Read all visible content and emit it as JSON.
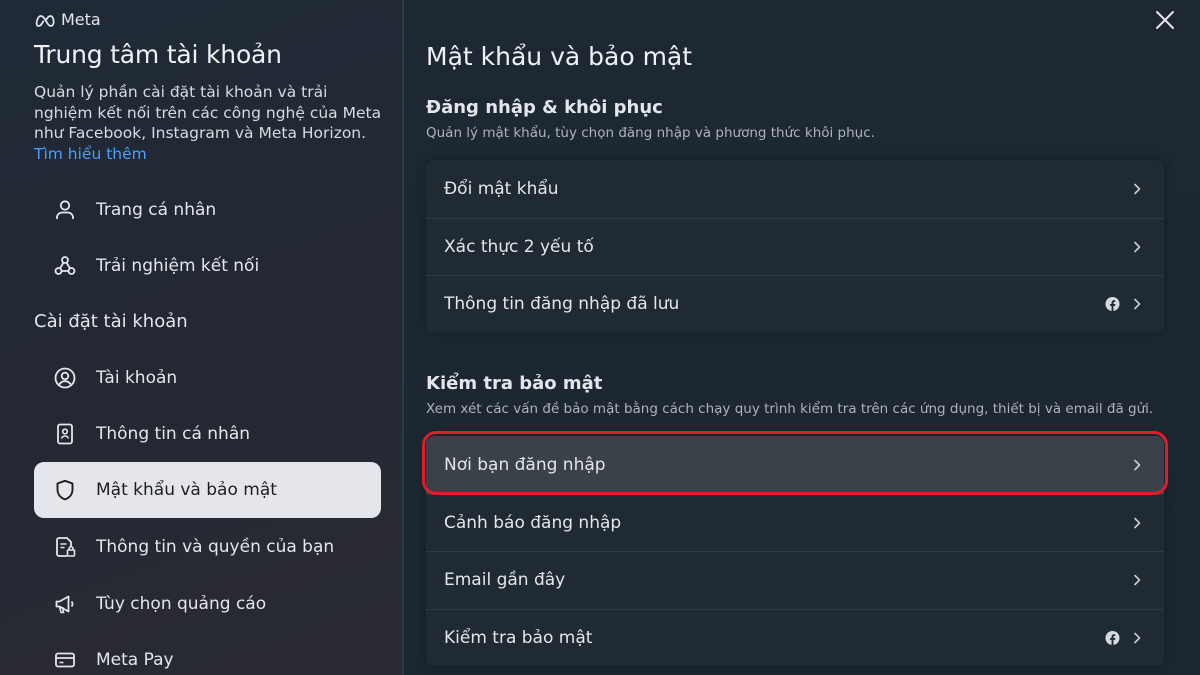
{
  "brand": {
    "logo_text": "Meta"
  },
  "sidebar": {
    "title": "Trung tâm tài khoản",
    "description": "Quản lý phần cài đặt tài khoản và trải nghiệm kết nối trên các công nghệ của Meta như Facebook, Instagram và Meta Horizon.",
    "learn_more": "Tìm hiểu thêm",
    "top_items": [
      {
        "label": "Trang cá nhân",
        "icon": "person-icon"
      },
      {
        "label": "Trải nghiệm kết nối",
        "icon": "connected-nodes-icon"
      }
    ],
    "section_label": "Cài đặt tài khoản",
    "items": [
      {
        "label": "Tài khoản",
        "icon": "account-circle-icon"
      },
      {
        "label": "Thông tin cá nhân",
        "icon": "id-card-icon"
      },
      {
        "label": "Mật khẩu và bảo mật",
        "icon": "shield-icon",
        "active": true
      },
      {
        "label": "Thông tin và quyền của bạn",
        "icon": "document-lock-icon"
      },
      {
        "label": "Tùy chọn quảng cáo",
        "icon": "megaphone-icon"
      },
      {
        "label": "Meta Pay",
        "icon": "credit-card-icon"
      }
    ]
  },
  "main": {
    "title": "Mật khẩu và bảo mật",
    "login_group": {
      "title": "Đăng nhập & khôi phục",
      "description": "Quản lý mật khẩu, tùy chọn đăng nhập và phương thức khôi phục.",
      "rows": [
        {
          "label": "Đổi mật khẩu"
        },
        {
          "label": "Xác thực 2 yếu tố"
        },
        {
          "label": "Thông tin đăng nhập đã lưu",
          "facebook_badge": true
        }
      ]
    },
    "security_group": {
      "title": "Kiểm tra bảo mật",
      "description": "Xem xét các vấn đề bảo mật bằng cách chạy quy trình kiểm tra trên các ứng dụng, thiết bị và email đã gửi.",
      "rows": [
        {
          "label": "Nơi bạn đăng nhập",
          "highlighted": true
        },
        {
          "label": "Cảnh báo đăng nhập"
        },
        {
          "label": "Email gần đây"
        },
        {
          "label": "Kiểm tra bảo mật",
          "facebook_badge": true
        }
      ]
    }
  },
  "colors": {
    "highlight_outline": "#e01e2a",
    "link": "#4a9fff",
    "active_nav_bg": "#e4e6eb"
  }
}
